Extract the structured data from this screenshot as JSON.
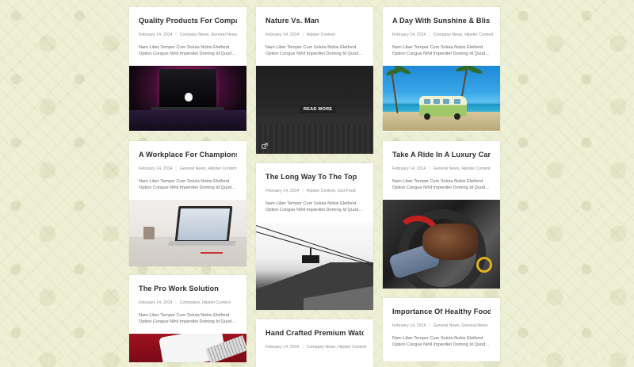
{
  "read_more_label": "READ MORE",
  "posts": [
    {
      "title": "Quality Products For Companies",
      "date": "February 14, 2014",
      "categories": "Company News, General News",
      "excerpt": "Nam Liber Tempor Cum Soluta Nobis Eleifend Option Congue Nihil Imperdiet Doming Id Quod…",
      "image": "macbook-dark-pink-light"
    },
    {
      "title": "Nature Vs. Man",
      "date": "February 14, 2014",
      "categories": "Hipster Content",
      "excerpt": "Nam Liber Tempor Cum Soluta Nobis Eleifend Option Congue Nihil Imperdiet Doming Id Quod…",
      "image": "foggy-field"
    },
    {
      "title": "A Day With Sunshine & Bliss",
      "date": "February 14, 2014",
      "categories": "Company News, Hipster Content",
      "excerpt": "Nam Liber Tempor Cum Soluta Nobis Eleifend Option Congue Nihil Imperdiet Doming Id Quod…",
      "image": "vw-van-beach"
    },
    {
      "title": "A Workplace For Champions",
      "date": "February 14, 2014",
      "categories": "General News, Hipster Content",
      "excerpt": "Nam Liber Tempor Cum Soluta Nobis Eleifend Option Congue Nihil Imperdiet Doming Id Quod…",
      "image": "desk-laptop"
    },
    {
      "title": "The Long Way To The Top",
      "date": "February 14, 2014",
      "categories": "Hipster Content, Just Food",
      "excerpt": "Nam Liber Tempor Cum Soluta Nobis Eleifend Option Congue Nihil Imperdiet Doming Id Quod…",
      "image": "cable-car-mountain"
    },
    {
      "title": "Take A Ride In A Luxury Car",
      "date": "February 14, 2014",
      "categories": "General News, Hipster Content",
      "excerpt": "Nam Liber Tempor Cum Soluta Nobis Eleifend Option Congue Nihil Imperdiet Doming Id Quod…",
      "image": "leather-glove-steering-wheel"
    },
    {
      "title": "The Pro Work Solution",
      "date": "February 14, 2014",
      "categories": "Computers, Hipster Content",
      "excerpt": "Nam Liber Tempor Cum Soluta Nobis Eleifend Option Congue Nihil Imperdiet Doming Id Quod…",
      "image": "tablet-keyboard-red"
    },
    {
      "title": "Hand Crafted Premium Watch",
      "date": "February 14, 2014",
      "categories": "Company News, Hipster Content",
      "excerpt": "",
      "image": ""
    },
    {
      "title": "Importance Of Healthy Food",
      "date": "February 14, 2014",
      "categories": "General News, General News",
      "excerpt": "Nam Liber Tempor Cum Soluta Nobis Eleifend Option Congue Nihil Imperdiet Doming Id Quod…",
      "image": ""
    }
  ],
  "icons": {
    "external_link": "external-link-icon"
  },
  "colors": {
    "background": "#eef0d6",
    "card": "#ffffff",
    "title": "#2c2c2c",
    "meta": "#8d8d8d"
  }
}
